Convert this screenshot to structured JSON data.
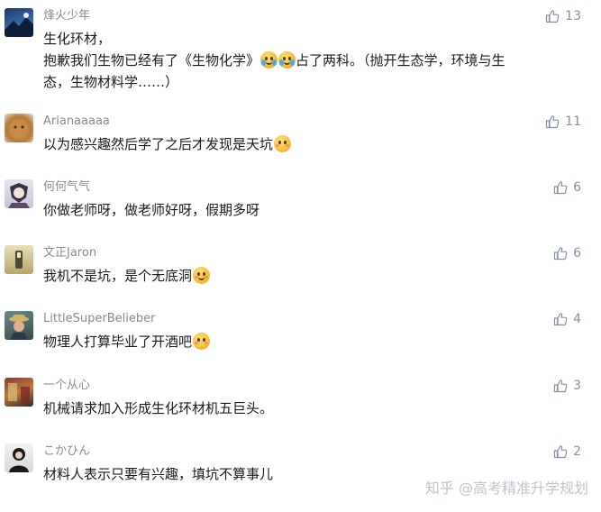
{
  "comments": [
    {
      "username": "烽火少年",
      "line1": "生化环材，",
      "line2a": "抱歉我们生物已经有了《生物化学》",
      "line2_emoji1": "crying-face-emoji",
      "line2_emoji2": "crying-face-emoji",
      "line2b": "占了两科。（抛开生态学，环境与生",
      "line3": "态，生物材料学……）",
      "likes": "13"
    },
    {
      "username": "Arianaaaaa",
      "text": "以为感兴趣然后学了之后才发现是天坑",
      "emoji": "flushed-face-emoji",
      "likes": "11"
    },
    {
      "username": "何何气气",
      "text": "你做老师呀，做老师好呀，假期多呀",
      "likes": "6"
    },
    {
      "username": "文正Jaron",
      "text": "我机不是坑，是个无底洞",
      "emoji": "grimacing-face-emoji",
      "likes": "6"
    },
    {
      "username": "LittleSuperBelieber",
      "text": "物理人打算毕业了开酒吧",
      "emoji": "flushed-face-emoji",
      "likes": "4"
    },
    {
      "username": "一个从心",
      "text": "机械请求加入形成生化环材机五巨头。",
      "likes": "3"
    },
    {
      "username": "こかひん",
      "text": "材料人表示只要有兴趣，填坑不算事儿",
      "likes": "2"
    }
  ],
  "watermark": "知乎 @高考精准升学规划",
  "colors": {
    "username": "#8a8a8a",
    "text": "#1a1a1a",
    "likes": "#8590a6",
    "background": "#ffffff"
  }
}
